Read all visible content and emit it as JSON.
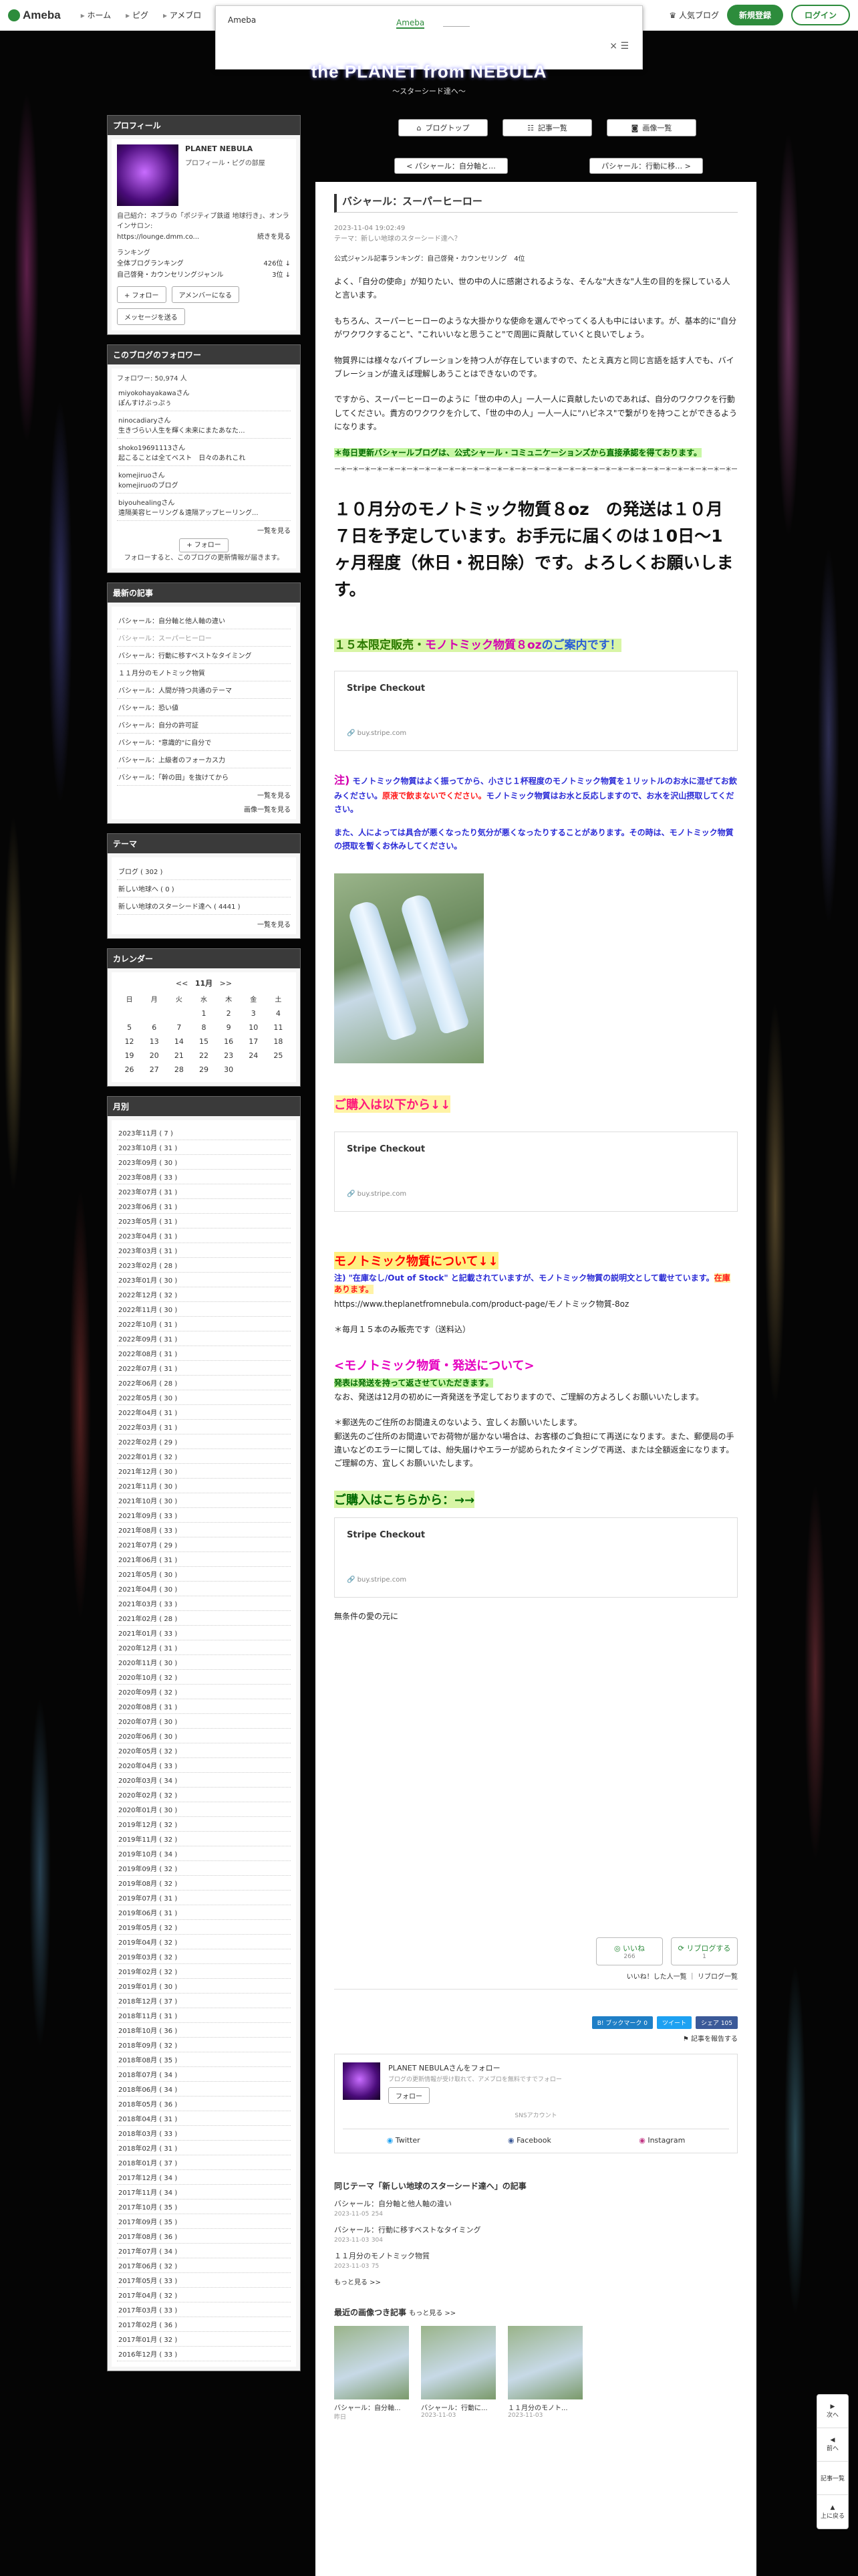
{
  "header": {
    "logo": "Ameba",
    "nav": [
      "ホーム",
      "ピグ",
      "アメブロ"
    ],
    "rank_link": "人気ブログ",
    "signup": "新規登録",
    "login": "ログイン"
  },
  "popup": {
    "label": "Ameba",
    "tab": "Ameba",
    "close": "× ☰"
  },
  "blog": {
    "title": "the PLANET from NEBULA",
    "subtitle": "〜スターシード達へ〜"
  },
  "header_nav": [
    "ブログトップ",
    "記事一覧",
    "画像一覧"
  ],
  "pager": {
    "prev": "< パシャール：自分軸と…",
    "next": "パシャール：行動に移… >"
  },
  "profile": {
    "heading": "プロフィール",
    "name": "PLANET NEBULA",
    "sub": "プロフィール・ピグの部屋",
    "intro": "自己紹介：ネブラの「ポジティブ鉄道 地球行き」、オンラインサロン:",
    "url": "https://lounge.dmm.co...",
    "more": "続きを見る",
    "ranking_label": "ランキング",
    "rows": [
      {
        "k": "全体ブログランキング",
        "v": "426位 ↓"
      },
      {
        "k": "自己啓発・カウンセリングジャンル",
        "v": "3位 ↓"
      }
    ],
    "follow_btn": "+ フォロー",
    "amember_btn": "アメンバーになる",
    "message_btn": "メッセージを送る"
  },
  "followers": {
    "heading": "このブログのフォロワー",
    "count": "フォロワー: 50,974 人",
    "items": [
      {
        "name": "miyokohayakawaさん",
        "note": "ぽんすけぶっぷぅ"
      },
      {
        "name": "ninocadiaryさん",
        "note": "生きづらい人生を輝く未来にまたあなた..."
      },
      {
        "name": "shoko19691113さん",
        "note": "起こることは全てベスト　日々のあれこれ"
      },
      {
        "name": "komejiruoさん",
        "note": "komejiruoのブログ"
      },
      {
        "name": "biyouhealingさん",
        "note": "遠隔美容ヒーリング＆遠隔アップヒーリング..."
      }
    ],
    "more": "一覧を見る",
    "follow_btn": "+ フォロー",
    "hint": "フォローすると、このブログの更新情報が届きます。"
  },
  "recent": {
    "heading": "最新の記事",
    "items": [
      "バシャール：自分軸と他人軸の違い",
      "バシャール：スーパーヒーロー",
      "バシャール：行動に移すベストなタイミング",
      "１１月分のモノトミック物質",
      "バシャール：人間が持つ共通のテーマ",
      "バシャール：恐い値",
      "バシャール：自分の許可証",
      "バシャール：\"意識的\"に自分で",
      "バシャール：上級者のフォーカス力",
      "バシャール：「幹の田」を抜けてから"
    ],
    "more": "一覧を見る",
    "images": "画像一覧を見る"
  },
  "themes": {
    "heading": "テーマ",
    "items": [
      "ブログ ( 302 )",
      "新しい地球へ ( 0 )",
      "新しい地球のスターシード達へ ( 4441 )"
    ],
    "more": "一覧を見る"
  },
  "calendar": {
    "heading": "カレンダー",
    "month": "11月",
    "prev": "<<",
    "next": ">>",
    "days": [
      "日",
      "月",
      "火",
      "水",
      "木",
      "金",
      "土"
    ],
    "weeks": [
      [
        "",
        "",
        "",
        "1",
        "2",
        "3",
        "4"
      ],
      [
        "5",
        "6",
        "7",
        "8",
        "9",
        "10",
        "11"
      ],
      [
        "12",
        "13",
        "14",
        "15",
        "16",
        "17",
        "18"
      ],
      [
        "19",
        "20",
        "21",
        "22",
        "23",
        "24",
        "25"
      ],
      [
        "26",
        "27",
        "28",
        "29",
        "30",
        "",
        ""
      ]
    ]
  },
  "months": {
    "heading": "月別",
    "items": [
      "2023年11月 ( 7 )",
      "2023年10月 ( 31 )",
      "2023年09月 ( 30 )",
      "2023年08月 ( 33 )",
      "2023年07月 ( 31 )",
      "2023年06月 ( 31 )",
      "2023年05月 ( 31 )",
      "2023年04月 ( 31 )",
      "2023年03月 ( 31 )",
      "2023年02月 ( 28 )",
      "2023年01月 ( 30 )",
      "2022年12月 ( 32 )",
      "2022年11月 ( 30 )",
      "2022年10月 ( 31 )",
      "2022年09月 ( 31 )",
      "2022年08月 ( 31 )",
      "2022年07月 ( 31 )",
      "2022年06月 ( 28 )",
      "2022年05月 ( 30 )",
      "2022年04月 ( 31 )",
      "2022年03月 ( 31 )",
      "2022年02月 ( 29 )",
      "2022年01月 ( 32 )",
      "2021年12月 ( 30 )",
      "2021年11月 ( 30 )",
      "2021年10月 ( 30 )",
      "2021年09月 ( 33 )",
      "2021年08月 ( 33 )",
      "2021年07月 ( 29 )",
      "2021年06月 ( 31 )",
      "2021年05月 ( 30 )",
      "2021年04月 ( 30 )",
      "2021年03月 ( 33 )",
      "2021年02月 ( 28 )",
      "2021年01月 ( 33 )",
      "2020年12月 ( 31 )",
      "2020年11月 ( 30 )",
      "2020年10月 ( 32 )",
      "2020年09月 ( 32 )",
      "2020年08月 ( 31 )",
      "2020年07月 ( 30 )",
      "2020年06月 ( 30 )",
      "2020年05月 ( 32 )",
      "2020年04月 ( 33 )",
      "2020年03月 ( 34 )",
      "2020年02月 ( 32 )",
      "2020年01月 ( 30 )",
      "2019年12月 ( 32 )",
      "2019年11月 ( 32 )",
      "2019年10月 ( 34 )",
      "2019年09月 ( 32 )",
      "2019年08月 ( 32 )",
      "2019年07月 ( 31 )",
      "2019年06月 ( 31 )",
      "2019年05月 ( 32 )",
      "2019年04月 ( 32 )",
      "2019年03月 ( 32 )",
      "2019年02月 ( 32 )",
      "2019年01月 ( 30 )",
      "2018年12月 ( 37 )",
      "2018年11月 ( 31 )",
      "2018年10月 ( 36 )",
      "2018年09月 ( 32 )",
      "2018年08月 ( 35 )",
      "2018年07月 ( 34 )",
      "2018年06月 ( 34 )",
      "2018年05月 ( 36 )",
      "2018年04月 ( 31 )",
      "2018年03月 ( 33 )",
      "2018年02月 ( 31 )",
      "2018年01月 ( 37 )",
      "2017年12月 ( 34 )",
      "2017年11月 ( 34 )",
      "2017年10月 ( 35 )",
      "2017年09月 ( 35 )",
      "2017年08月 ( 36 )",
      "2017年07月 ( 34 )",
      "2017年06月 ( 32 )",
      "2017年05月 ( 33 )",
      "2017年04月 ( 32 )",
      "2017年03月 ( 33 )",
      "2017年02月 ( 36 )",
      "2017年01月 ( 32 )",
      "2016年12月 ( 33 )"
    ]
  },
  "entry": {
    "title": "バシャール：スーパーヒーロー",
    "date": "2023-11-04 19:02:49",
    "theme": "テーマ：新しい地球のスターシード達へ？",
    "rank": "公式ジャンル記事ランキング：自己啓発・カウンセリング　4位",
    "p1": "よく、「自分の使命」が知りたい、世の中の人に感謝されるような、そんな\"大きな\"人生の目的を探している人と言います。",
    "p2": "もちろん、スーパーヒーローのような大掛かりな使命を選んでやってくる人も中にはいます。が、基本的に\"自分がワクワクすること\"、\"これいいなと思うこと\"で周囲に貢献していくと良いでしょう。",
    "p3": "物質界には様々なバイブレーションを持つ人が存在していますので、たとえ真方と同じ言語を話す人でも、バイブレーションが違えば理解しあうことはできないのです。",
    "p4": "ですから、スーパーヒーローのように「世の中の人」一人一人に貢献したいのであれば、自分のワクワクを行動してください。貴方のワクワクを介して、「世の中の人」一人一人に\"ハピネス\"で繋がりを持つことができるようになります。",
    "p5": "＊毎日更新バシャールブログは、公式シャール・コミュニケーションズから直接承認を得ております。",
    "divider": "ー＊ー＊ー＊ー＊ー＊ー＊ー＊ー＊ー＊ー＊ー＊ー＊ー＊ー＊ー＊ー＊ー＊ー＊ー＊ー＊ー＊ー＊ー＊ー＊ー＊ー＊ー＊ー＊ー＊ー＊ー＊ー＊ー＊ー＊ー＊ー",
    "big": "１０月分のモノトミック物質８oz　の発送は１０月７日を予定しています。お手元に届くのは１0日〜1ヶ月程度（休日・祝日除）です。よろしくお願いします。",
    "h1a": "１５本限定販売・",
    "h1b": "モノトミック物質８oz",
    "h1c": "のご案内です！",
    "card_title": "Stripe Checkout",
    "card_url": "buy.stripe.com",
    "note1_mark": "注)",
    "note1": "モノトミック物質はよく振ってから、小さじ１杯程度のモノトミック物質を１リットルのお水に混ぜてお飲みください。",
    "note1_red": "原液で飲まないでください。",
    "note1_end": "モノトミック物質はお水と反応しますので、お水を沢山摂取してください。",
    "note2": "また、人によっては具合が悪くなったり気分が悪くなったりすることがあります。その時は、モノトミック物質の摂取を暫くお休みしてください。",
    "buy_h": "ご購入は以下から↓↓",
    "about_h": "モノトミック物質について↓↓",
    "about_1": "注) \"在庫なし/Out of Stock\" と記載されていますが、モノトミック物質の説明文として載せています。",
    "about_1_red": "在庫あります。",
    "about_url": "https://www.theplanetfromnebula.com/product-page/モノトミック物質-8oz",
    "about_2": "＊毎月１５本のみ販売です（送料込）",
    "ship_h": "<モノトミック物質・発送について>",
    "ship_1": "発表は発送を持って返させていただきます。",
    "ship_2": "なお、発送は12月の初めに一斉発送を予定しておりますので、ご理解の方よろしくお願いいたします。",
    "ship_3": "＊郵送先のご住所のお間違えのないよう、宜しくお願いいたします。",
    "ship_4": "郵送先のご住所のお間違いでお荷物が届かない場合は、お客様のご負担にて再送になります。また、郵便局の手違いなどのエラーに関しては、紛失届けやエラーが認められたタイミングで再送、または全額返金になります。ご理解の方、宜しくお願いいたします。",
    "order_h": "ご購入はこちらから：→→",
    "sign": "無条件の愛の元に"
  },
  "actions": {
    "like": "いいね",
    "like_count": "266",
    "reblog": "リブログする",
    "reblog_count": "1",
    "like_list": "いいね！した人一覧",
    "reblog_list": "リブログ一覧"
  },
  "share": {
    "bookmark": "B! ブックマーク 0",
    "tweet": "ツイート",
    "fb": "シェア 105",
    "report": "記事を報告する"
  },
  "follow_box": {
    "name": "PLANET NEBULAさんをフォロー",
    "desc": "ブログの更新情報が受け取れて、アメブロを無料ですでフォロー",
    "btn": "フォロー",
    "count": "SNSアカウント",
    "twitter": "Twitter",
    "facebook": "Facebook",
    "instagram": "Instagram"
  },
  "related": {
    "heading": "同じテーマ「新しい地球のスターシード達へ」の記事",
    "items": [
      {
        "t": "バシャール：自分軸と他人軸の違い",
        "d": "2023-11-05",
        "c": "254"
      },
      {
        "t": "バシャール：行動に移すベストなタイミング",
        "d": "2023-11-03",
        "c": "304"
      },
      {
        "t": "１１月分のモノトミック物質",
        "d": "2023-11-03",
        "c": "75"
      }
    ],
    "more": "もっと見る >>"
  },
  "images": {
    "heading": "最近の画像つき記事",
    "more": "もっと見る >>",
    "items": [
      {
        "t": "バシャール：自分軸...",
        "d": "昨日"
      },
      {
        "t": "バシャール：行動に...",
        "d": "2023-11-03"
      },
      {
        "t": "１１月分のモノト...",
        "d": "2023-11-03"
      }
    ]
  },
  "floaters": [
    "次へ",
    "前へ",
    "記事一覧",
    "上に戻る"
  ]
}
